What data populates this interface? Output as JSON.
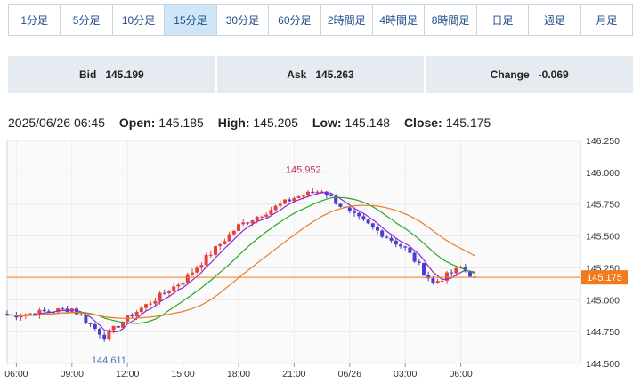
{
  "tabs": [
    {
      "label": "1分足",
      "active": false
    },
    {
      "label": "5分足",
      "active": false
    },
    {
      "label": "10分足",
      "active": false
    },
    {
      "label": "15分足",
      "active": true
    },
    {
      "label": "30分足",
      "active": false
    },
    {
      "label": "60分足",
      "active": false
    },
    {
      "label": "2時間足",
      "active": false
    },
    {
      "label": "4時間足",
      "active": false
    },
    {
      "label": "8時間足",
      "active": false
    },
    {
      "label": "日足",
      "active": false
    },
    {
      "label": "週足",
      "active": false
    },
    {
      "label": "月足",
      "active": false
    }
  ],
  "quotes": {
    "bid_label": "Bid",
    "bid_value": "145.199",
    "ask_label": "Ask",
    "ask_value": "145.263",
    "change_label": "Change",
    "change_value": "-0.069"
  },
  "ohlc": {
    "datetime": "2025/06/26 06:45",
    "open_label": "Open:",
    "open": "145.185",
    "high_label": "High:",
    "high": "145.205",
    "low_label": "Low:",
    "low": "145.148",
    "close_label": "Close:",
    "close": "145.175"
  },
  "colors": {
    "up": "#e8403a",
    "down": "#4a3fc9",
    "ma_short": "#8a2bd4",
    "ma_mid": "#2aa82a",
    "ma_long": "#ee7a22",
    "current_price": "#f27a1a",
    "annotation": "#c0306a",
    "low_annotation": "#4a72b8"
  },
  "chart_data": {
    "type": "candlestick",
    "ylim": [
      144.5,
      146.25
    ],
    "y_ticks": [
      "146.250",
      "146.000",
      "145.750",
      "145.500",
      "145.250",
      "145.000",
      "144.750",
      "144.500"
    ],
    "x_ticks": [
      "06:00",
      "09:00",
      "12:00",
      "15:00",
      "18:00",
      "21:00",
      "06/26",
      "03:00",
      "06:00"
    ],
    "grid": true,
    "current_price": 145.175,
    "current_price_label": "145.175",
    "annotations": [
      {
        "label": "145.952",
        "value": 145.952,
        "kind": "high"
      },
      {
        "label": "144.611",
        "value": 144.611,
        "kind": "low"
      }
    ],
    "key_points": [
      {
        "t": "06:00",
        "close": 144.88
      },
      {
        "t": "09:00",
        "close": 144.93
      },
      {
        "t": "10:45",
        "close": 144.71
      },
      {
        "t": "12:00",
        "close": 144.86
      },
      {
        "t": "15:00",
        "close": 145.15
      },
      {
        "t": "18:00",
        "close": 145.58
      },
      {
        "t": "21:00",
        "close": 145.8
      },
      {
        "t": "22:30",
        "close": 145.86
      },
      {
        "t": "00:00",
        "close": 145.68
      },
      {
        "t": "03:00",
        "close": 145.4
      },
      {
        "t": "04:30",
        "close": 145.13
      },
      {
        "t": "06:00",
        "close": 145.25
      },
      {
        "t": "06:45",
        "close": 145.175
      }
    ],
    "series": [
      {
        "kind": "candles"
      },
      {
        "kind": "ma_short"
      },
      {
        "kind": "ma_mid"
      },
      {
        "kind": "ma_long"
      }
    ]
  }
}
